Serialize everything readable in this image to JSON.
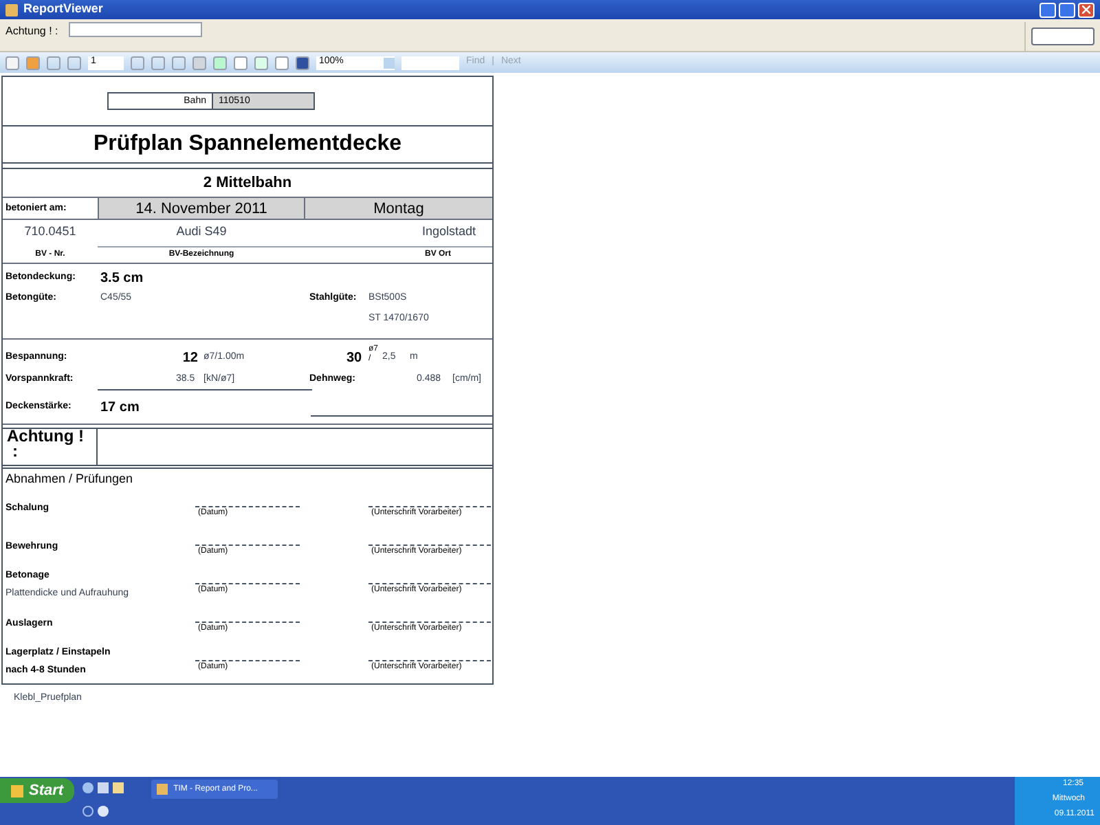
{
  "window": {
    "title": "ReportViewer"
  },
  "parameters": {
    "label": "Achtung ! :"
  },
  "toolbar": {
    "page": "1",
    "zoom": "100%",
    "find": "Find",
    "separator": "|",
    "next": "Next"
  },
  "report": {
    "bahn_label": "Bahn",
    "bahn_value": "110510",
    "title": "Prüfplan Spannelementdecke",
    "subtitle": "2 Mittelbahn",
    "date_label": "betoniert am:",
    "date": "14. November 2011",
    "weekday": "Montag",
    "project": [
      {
        "value": "710.0451",
        "label": "BV - Nr."
      },
      {
        "value": "Audi S49",
        "label": "BV-Bezeichnung"
      },
      {
        "value": "Ingolstadt",
        "label": "BV Ort"
      }
    ],
    "betondeckung": {
      "label": "Betondeckung:",
      "value": "3.5  cm"
    },
    "betonguete": {
      "label": "Betongüte:",
      "value": "C45/55"
    },
    "stahlguete": {
      "label": "Stahlgüte:",
      "values": [
        "BSt500S",
        "ST 1470/1670"
      ]
    },
    "bespannung": {
      "label": "Bespannung:",
      "count": "12",
      "unit": "ø7/1.00m",
      "count2": "30",
      "unit2_top": "ø7",
      "unit2_bottom": "/",
      "value2": "2,5",
      "unit3": "m"
    },
    "vorspannkraft": {
      "label": "Vorspannkraft:",
      "value": "38.5",
      "unit": "[kN/ø7]"
    },
    "dehnweg": {
      "label": "Dehnweg:",
      "value": "0.488",
      "unit": "[cm/m]"
    },
    "deckenstaerke": {
      "label": "Deckenstärke:",
      "value": "17  cm"
    },
    "achtung": {
      "label": "Achtung !",
      "colon": ":"
    },
    "checks_title": "Abnahmen / Prüfungen",
    "checks": [
      {
        "title": "Schalung",
        "date": "(Datum)",
        "sign": "(Unterschrift Vorarbeiter)"
      },
      {
        "title": "Bewehrung",
        "date": "(Datum)",
        "sign": "(Unterschrift Vorarbeiter)"
      },
      {
        "title": "Betonage",
        "subtitle": "Plattendicke und Aufrauhung",
        "subtitle_bold": false,
        "date": "(Datum)",
        "sign": "(Unterschrift Vorarbeiter)"
      },
      {
        "title": "Auslagern",
        "date": "(Datum)",
        "sign": "(Unterschrift Vorarbeiter)"
      },
      {
        "title": "Lagerplatz / Einstapeln",
        "subtitle": "nach 4-8 Stunden",
        "subtitle_bold": true,
        "date": "(Datum)",
        "sign": "(Unterschrift Vorarbeiter)"
      }
    ],
    "footer": "Klebl_Pruefplan"
  },
  "taskbar": {
    "start": "Start",
    "task": "TIM - Report and Pro...",
    "time": "12:35",
    "day": "Mittwoch",
    "date": "09.11.2011"
  }
}
